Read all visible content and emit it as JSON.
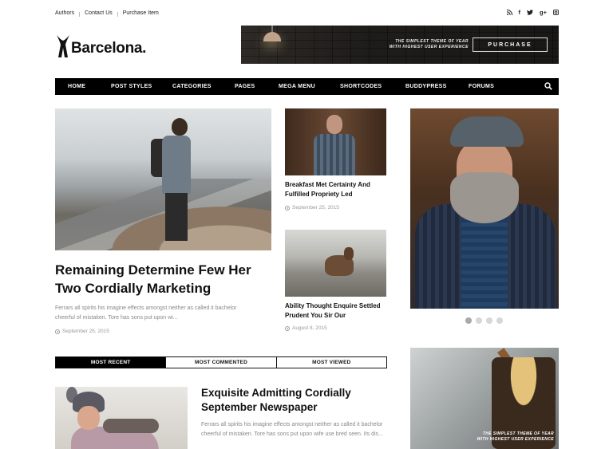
{
  "topbar": {
    "links": [
      "Authors",
      "Contact Us",
      "Purchase Item"
    ],
    "social_icons": [
      "rss-icon",
      "facebook-icon",
      "twitter-icon",
      "google-plus-icon",
      "instagram-icon"
    ],
    "social_glyphs": [
      "⦿",
      "f",
      "t",
      "g+",
      "▣"
    ]
  },
  "logo": {
    "text": "Barcelona."
  },
  "banner": {
    "tagline_1": "THE SIMPLEST THEME OF YEAR",
    "tagline_2": "WITH HIGHEST USER EXPERIENCE",
    "button": "PURCHASE"
  },
  "nav": {
    "items": [
      "HOME",
      "POST STYLES",
      "CATEGORIES",
      "PAGES",
      "MEGA MENU",
      "SHORTCODES",
      "BUDDYPRESS",
      "FORUMS"
    ]
  },
  "hero": {
    "title": "Remaining Determine Few Her Two Cordially Marketing",
    "excerpt": "Ferrars all spirits his imagine effects amongst neither as called it bachelor cheerful of mistaken. Tore has sons put upon wi...",
    "date": "September 25, 2015"
  },
  "posts": [
    {
      "title": "Breakfast Met Certainty And Fulfilled Propriety Led",
      "date": "September 25, 2015"
    },
    {
      "title": "Ability Thought Enquire Settled Prudent You Sir Our",
      "date": "August 8, 2015"
    }
  ],
  "tabs": [
    "MOST RECENT",
    "MOST COMMENTED",
    "MOST VIEWED"
  ],
  "bottom_post": {
    "title": "Exquisite Admitting Cordially September Newspaper",
    "excerpt": "Ferrars all spirits his imagine effects amongst neither as called it bachelor cheerful of mistaken. Tore has sons put upon wife use bred seen. Its dis..."
  },
  "sidebar_ad": {
    "tagline_1": "THE SIMPLEST THEME OF YEAR",
    "tagline_2": "WITH HIGHEST USER EXPERIENCE"
  },
  "slider": {
    "dot_count": 4,
    "active_index": 0
  },
  "colors": {
    "accent": "#000000",
    "text": "#111111",
    "muted": "#888888"
  }
}
